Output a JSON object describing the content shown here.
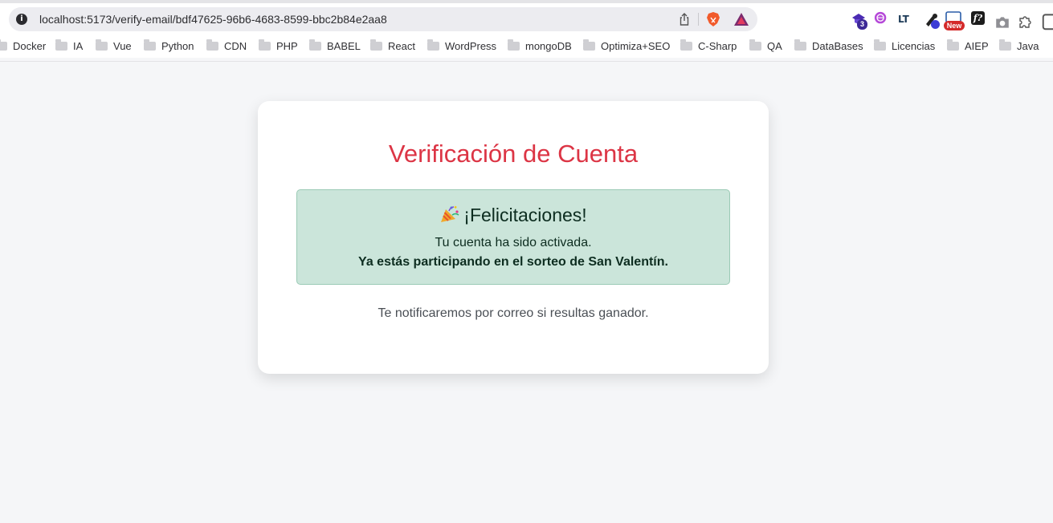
{
  "browser": {
    "url": "localhost:5173/verify-email/bdf47625-96b6-4683-8599-bbc2b84e2aa8",
    "site_info_glyph": "i",
    "extensions": [
      {
        "name": "extension-3-icon",
        "badge": "3"
      },
      {
        "name": "extension-globe-icon",
        "badge": ""
      },
      {
        "name": "languagetool-icon",
        "label": "LT"
      },
      {
        "name": "extension-dropper-icon",
        "badge": ""
      },
      {
        "name": "extension-new-icon",
        "badge": "New"
      },
      {
        "name": "extension-font-icon",
        "label": "f?"
      },
      {
        "name": "camera-icon"
      },
      {
        "name": "puzzle-icon"
      }
    ],
    "bookmarks": [
      "Docker",
      "IA",
      "Vue",
      "Python",
      "CDN",
      "PHP",
      "BABEL",
      "React",
      "WordPress",
      "mongoDB",
      "Optimiza+SEO",
      "C-Sharp",
      "QA",
      "DataBases",
      "Licencias",
      "AIEP",
      "Java"
    ]
  },
  "colors": {
    "title": "#dc3545",
    "alert_bg": "#cbe5da",
    "alert_text": "#0d2d20",
    "page_bg": "#f5f6f8"
  },
  "page": {
    "title": "Verificación de Cuenta",
    "alert": {
      "icon": "party-popper-icon",
      "heading": "¡Felicitaciones!",
      "line1": "Tu cuenta ha sido activada.",
      "line2": "Ya estás participando en el sorteo de San Valentín."
    },
    "notice": "Te notificaremos por correo si resultas ganador."
  }
}
